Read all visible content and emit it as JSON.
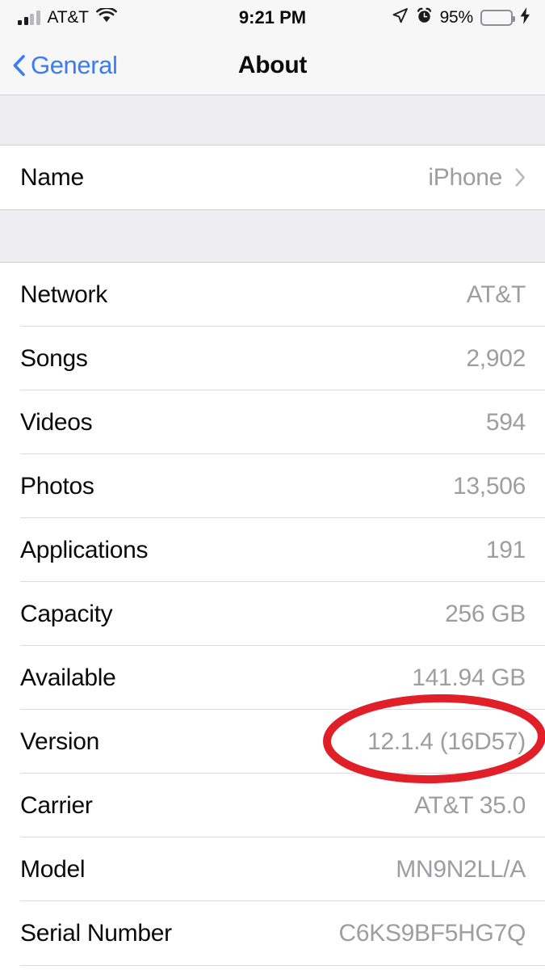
{
  "status_bar": {
    "carrier": "AT&T",
    "signal_bars_filled": 2,
    "signal_bars_total": 4,
    "wifi_icon": "wifi-icon",
    "time": "9:21 PM",
    "location_icon": "location-arrow-icon",
    "alarm_icon": "alarm-clock-icon",
    "battery_percent": "95%",
    "battery_level": 95,
    "battery_color": "#6fd96f",
    "charging": true,
    "charging_icon": "lightning-bolt-icon"
  },
  "nav_bar": {
    "back_label": "General",
    "back_icon": "chevron-left-icon",
    "title": "About",
    "accent_color": "#3c7bf6"
  },
  "name_section": {
    "rows": [
      {
        "label": "Name",
        "value": "iPhone",
        "chevron": true
      }
    ]
  },
  "info_section": {
    "rows": [
      {
        "label": "Network",
        "value": "AT&T"
      },
      {
        "label": "Songs",
        "value": "2,902"
      },
      {
        "label": "Videos",
        "value": "594"
      },
      {
        "label": "Photos",
        "value": "13,506"
      },
      {
        "label": "Applications",
        "value": "191"
      },
      {
        "label": "Capacity",
        "value": "256 GB"
      },
      {
        "label": "Available",
        "value": "141.94 GB"
      },
      {
        "label": "Version",
        "value": "12.1.4 (16D57)"
      },
      {
        "label": "Carrier",
        "value": "AT&T 35.0"
      },
      {
        "label": "Model",
        "value": "MN9N2LL/A"
      },
      {
        "label": "Serial Number",
        "value": "C6KS9BF5HG7Q"
      }
    ]
  },
  "annotation": {
    "shape": "ellipse",
    "target_row_label": "Version",
    "target_value": "12.1.4 (16D57)",
    "color": "#e01f29",
    "stroke_width": 10
  }
}
